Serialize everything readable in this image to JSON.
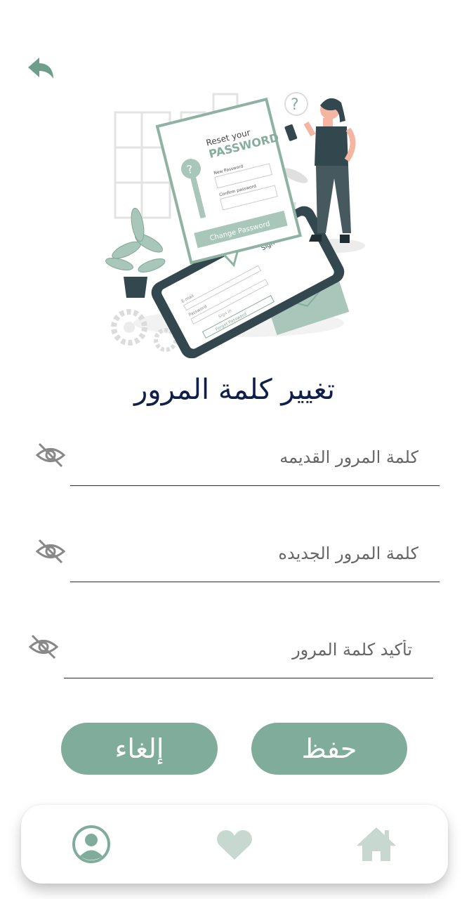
{
  "header": {
    "back_icon": "back-arrow-icon"
  },
  "illustration": {
    "card_title_line1": "Reset your",
    "card_title_line2": "PASSWORD",
    "card_field1": "New Password",
    "card_field2": "Confirm password",
    "card_button": "Change Password",
    "phone_title": "Sign in",
    "phone_email": "E-mail",
    "phone_password": "Password",
    "phone_signin": "Sign in",
    "phone_forgot": "Forgot Password",
    "question_mark": "?"
  },
  "title": "تغيير كلمة المرور",
  "form": {
    "old_password": {
      "placeholder": "كلمة المرور القديمه",
      "value": ""
    },
    "new_password": {
      "placeholder": "كلمة المرور الجديده",
      "value": ""
    },
    "confirm_password": {
      "placeholder": "تأكيد كلمة المرور",
      "value": ""
    }
  },
  "buttons": {
    "save": "حفظ",
    "cancel": "إلغاء"
  },
  "nav": {
    "items": [
      "profile-icon",
      "heart-icon",
      "home-icon"
    ]
  },
  "colors": {
    "accent": "#80ad9b",
    "title": "#0f1f4a",
    "icon_gray": "#888888",
    "nav_inactive": "#c6d8d0"
  }
}
